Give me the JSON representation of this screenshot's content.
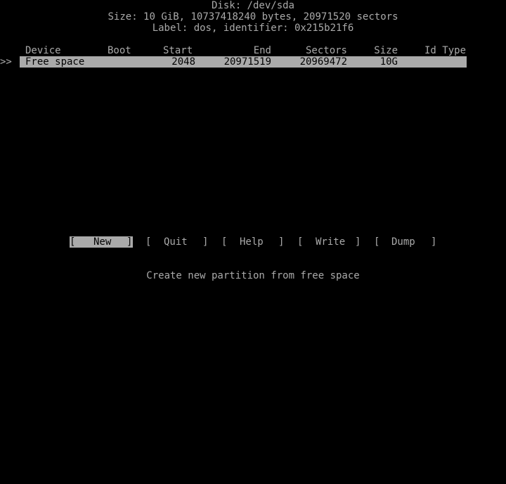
{
  "header": {
    "disk_line": "Disk: /dev/sda",
    "size_line": "Size: 10 GiB, 10737418240 bytes, 20971520 sectors",
    "label_line": "Label: dos, identifier: 0x215b21f6"
  },
  "table": {
    "columns": {
      "device": "Device",
      "boot": "Boot",
      "start": "Start",
      "end": "End",
      "sectors": "Sectors",
      "size": "Size",
      "id_type": "Id Type"
    },
    "rows": [
      {
        "marker": ">>",
        "device": "Free space",
        "boot": "",
        "start": "2048",
        "end": "20971519",
        "sectors": "20969472",
        "size": "10G",
        "id_type": ""
      }
    ]
  },
  "menu": {
    "buttons": [
      {
        "left": "[",
        "label": "New",
        "right": "]"
      },
      {
        "left": "[",
        "label": "Quit",
        "right": "]"
      },
      {
        "left": "[",
        "label": "Help",
        "right": "]"
      },
      {
        "left": "[",
        "label": "Write",
        "right": "]"
      },
      {
        "left": "[",
        "label": "Dump",
        "right": "]"
      }
    ],
    "selected_index": 0
  },
  "status": {
    "hint": "Create new partition from free space"
  },
  "colors": {
    "background": "#000000",
    "foreground": "#aaaaaa",
    "highlight_bg": "#aaaaaa",
    "highlight_fg": "#000000"
  }
}
